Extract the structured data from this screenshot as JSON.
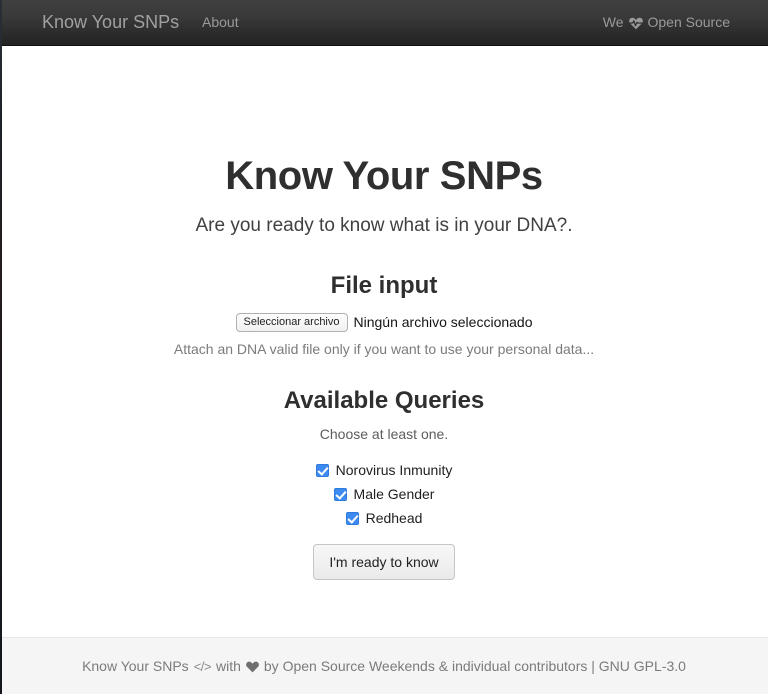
{
  "navbar": {
    "brand": "Know Your SNPs",
    "about_label": "About",
    "right_prefix": "We",
    "right_icon": "heartbeat-icon",
    "right_suffix": "Open Source"
  },
  "main": {
    "title": "Know Your SNPs",
    "subtitle": "Are you ready to know what is in your DNA?.",
    "file_section": {
      "heading": "File input",
      "select_button_label": "Seleccionar archivo",
      "file_status": "Ningún archivo seleccionado",
      "help_text": "Attach an DNA valid file only if you want to use your personal data..."
    },
    "queries_section": {
      "heading": "Available Queries",
      "instruction": "Choose at least one.",
      "items": [
        {
          "label": "Norovirus Inmunity",
          "checked": true
        },
        {
          "label": "Male Gender",
          "checked": true
        },
        {
          "label": "Redhead",
          "checked": true
        }
      ],
      "submit_label": "I'm ready to know"
    }
  },
  "footer": {
    "project": "Know Your SNPs",
    "code_icon": "</>",
    "with_text": "with",
    "heart_icon": "heart-icon",
    "by_text": "by Open Source Weekends & individual contributors | GNU GPL-3.0"
  },
  "colors": {
    "navbar_bg": "#222222",
    "navbar_text": "#9a9a9a",
    "accent_checkbox": "#3d8bf2",
    "body_text": "#333333",
    "muted_text": "#7b7b7b",
    "footer_bg": "#f5f5f5"
  }
}
